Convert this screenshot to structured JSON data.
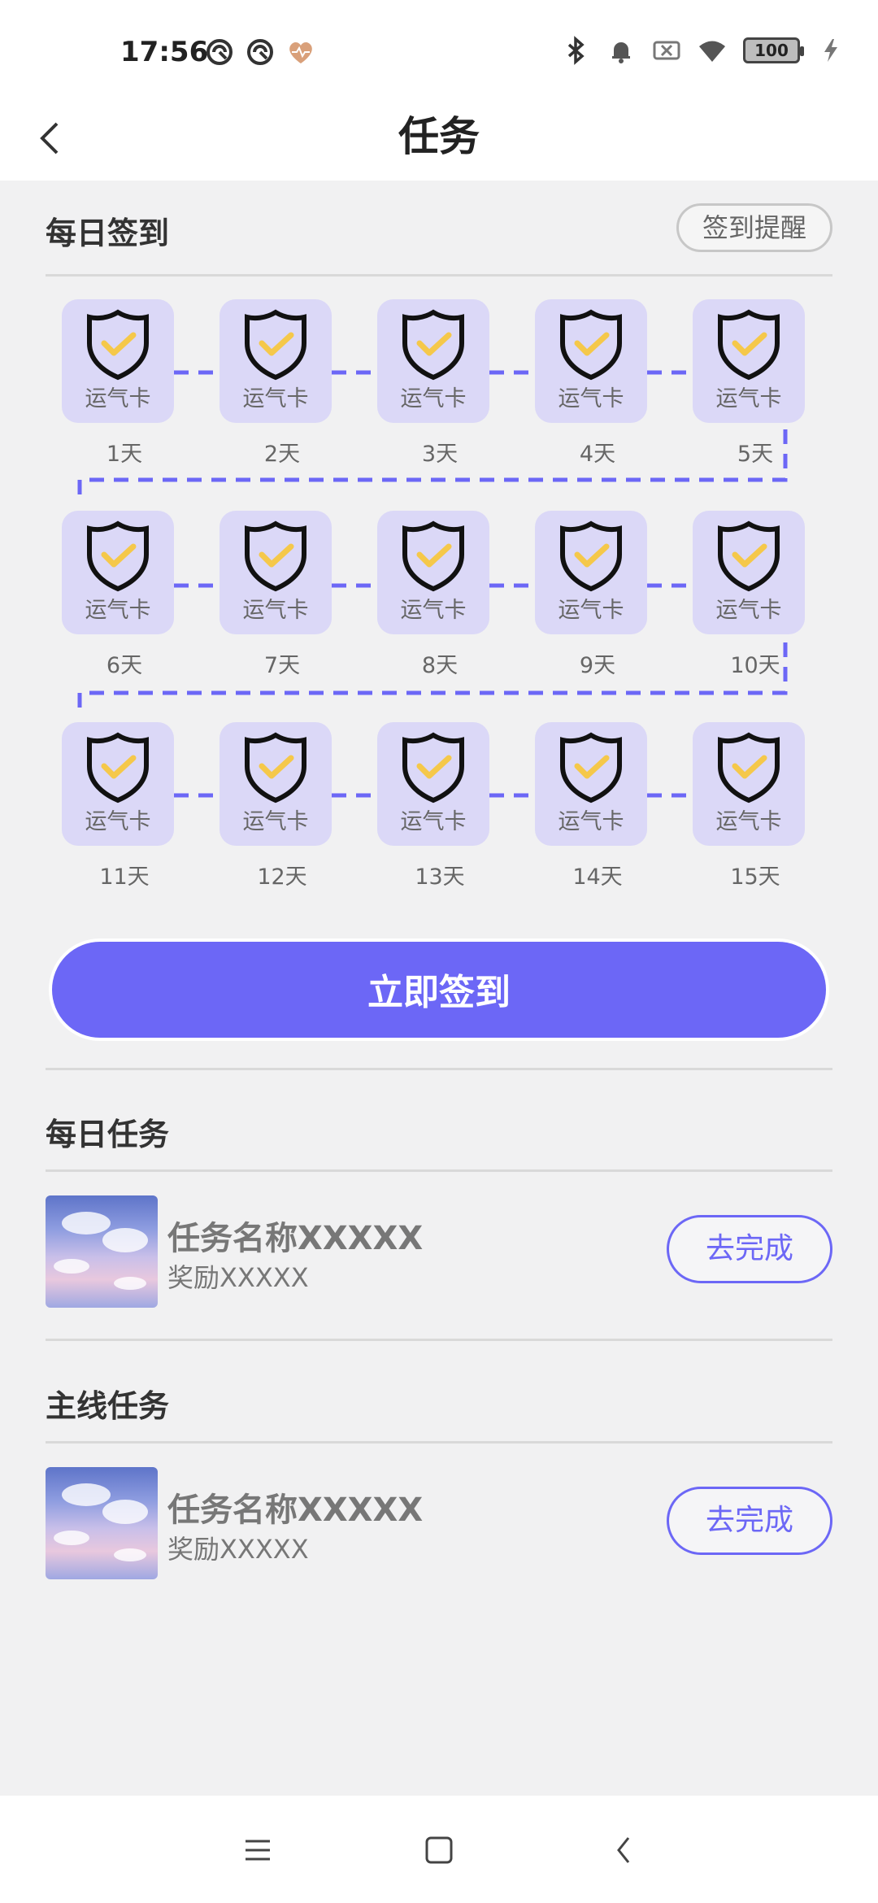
{
  "status_bar": {
    "time": "17:56",
    "battery": "100",
    "icons_left": [
      "vpn-icon",
      "vpn-icon-2",
      "health-heart-icon"
    ],
    "icons_right": [
      "bluetooth-icon",
      "bell-icon",
      "sim-off-icon",
      "wifi-icon",
      "battery-icon",
      "charging-icon"
    ]
  },
  "header": {
    "title": "任务",
    "back_icon": "chevron-left-icon"
  },
  "checkin": {
    "title": "每日签到",
    "remind_label": "签到提醒",
    "card_text": "运气卡",
    "days": [
      "1天",
      "2天",
      "3天",
      "4天",
      "5天",
      "6天",
      "7天",
      "8天",
      "9天",
      "10天",
      "11天",
      "12天",
      "13天",
      "14天",
      "15天"
    ],
    "button_label": "立即签到"
  },
  "daily_tasks": {
    "title": "每日任务",
    "items": [
      {
        "name": "任务名称XXXXX",
        "reward": "奖励XXXXX",
        "action": "去完成"
      }
    ]
  },
  "main_tasks": {
    "title": "主线任务",
    "items": [
      {
        "name": "任务名称XXXXX",
        "reward": "奖励XXXXX",
        "action": "去完成"
      }
    ]
  },
  "colors": {
    "accent": "#6c67f6",
    "card_bg": "#dbd8f7",
    "check": "#f5c84a"
  },
  "navbar": {
    "icons": [
      "menu-icon",
      "home-square-icon",
      "back-triangle-icon"
    ]
  }
}
